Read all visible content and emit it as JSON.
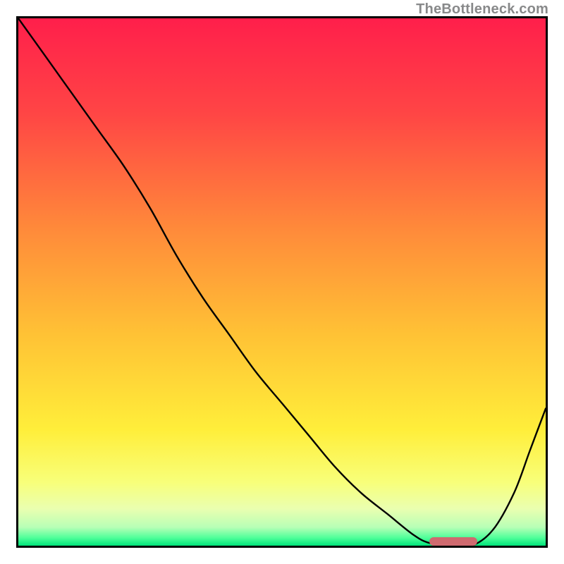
{
  "watermark": "TheBottleneck.com",
  "chart_data": {
    "type": "line",
    "title": "",
    "xlabel": "",
    "ylabel": "",
    "xlim": [
      0,
      100
    ],
    "ylim": [
      0,
      100
    ],
    "grid": false,
    "gradient_stops": [
      {
        "offset": 0.0,
        "color": "#ff1f4b"
      },
      {
        "offset": 0.18,
        "color": "#ff4545"
      },
      {
        "offset": 0.4,
        "color": "#ff8a3a"
      },
      {
        "offset": 0.6,
        "color": "#ffc235"
      },
      {
        "offset": 0.78,
        "color": "#ffee3a"
      },
      {
        "offset": 0.88,
        "color": "#f8ff7a"
      },
      {
        "offset": 0.93,
        "color": "#eaffb0"
      },
      {
        "offset": 0.965,
        "color": "#b8ffb6"
      },
      {
        "offset": 0.985,
        "color": "#4fff9a"
      },
      {
        "offset": 1.0,
        "color": "#00e47a"
      }
    ],
    "series": [
      {
        "name": "bottleneck-curve",
        "x": [
          0,
          5,
          10,
          15,
          20,
          25,
          30,
          35,
          40,
          45,
          50,
          55,
          60,
          65,
          70,
          75,
          78,
          82,
          86,
          90,
          94,
          97,
          100
        ],
        "y": [
          100,
          93,
          86,
          79,
          72,
          64,
          55,
          47,
          40,
          33,
          27,
          21,
          15,
          10,
          6,
          2,
          0.5,
          0,
          0,
          3,
          10,
          18,
          26
        ]
      }
    ],
    "optimal_marker": {
      "x_start": 78,
      "x_end": 87,
      "y": 0.5
    }
  }
}
